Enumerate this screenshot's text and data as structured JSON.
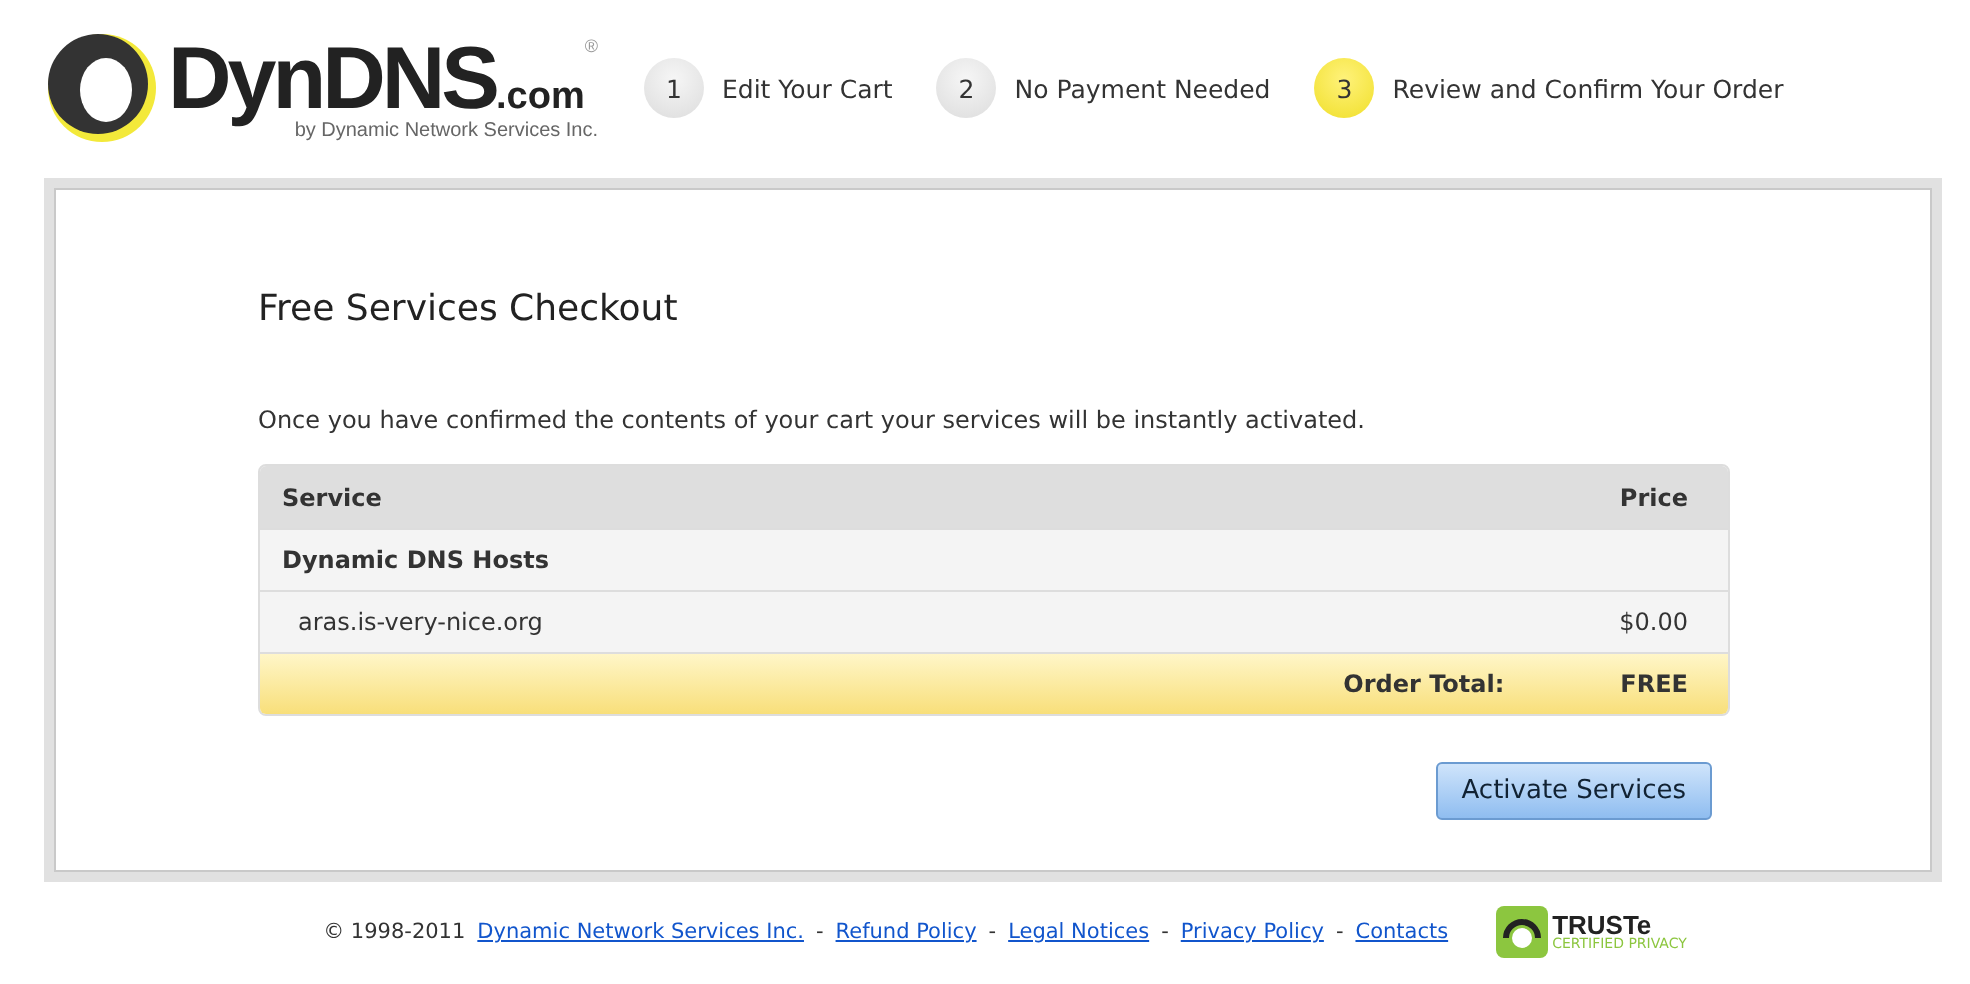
{
  "logo": {
    "name": "DynDNS",
    "suffix": ".com",
    "mark": "®",
    "tagline": "by Dynamic Network Services Inc."
  },
  "steps": [
    {
      "number": "1",
      "label": "Edit Your Cart",
      "selected": false
    },
    {
      "number": "2",
      "label": "No Payment Needed",
      "selected": false
    },
    {
      "number": "3",
      "label": "Review and Confirm Your Order",
      "selected": true
    }
  ],
  "checkout": {
    "title": "Free Services Checkout",
    "intro": "Once you have confirmed the contents of your cart your services will be instantly activated.",
    "table": {
      "columns": [
        "Service",
        "Price"
      ],
      "groups": [
        {
          "name": "Dynamic DNS Hosts",
          "rows": [
            {
              "service": "aras.is-very-nice.org",
              "price": "$0.00"
            }
          ]
        }
      ],
      "total_label": "Order Total:",
      "total_value": "FREE"
    },
    "button": "Activate Services"
  },
  "footer": {
    "copyright": "© 1998-2011",
    "links": [
      "Dynamic Network Services Inc.",
      "Refund Policy",
      "Legal Notices",
      "Privacy Policy",
      "Contacts"
    ],
    "separator": "-",
    "badge": {
      "name": "TRUSTe",
      "caption": "CERTIFIED PRIVACY"
    }
  }
}
